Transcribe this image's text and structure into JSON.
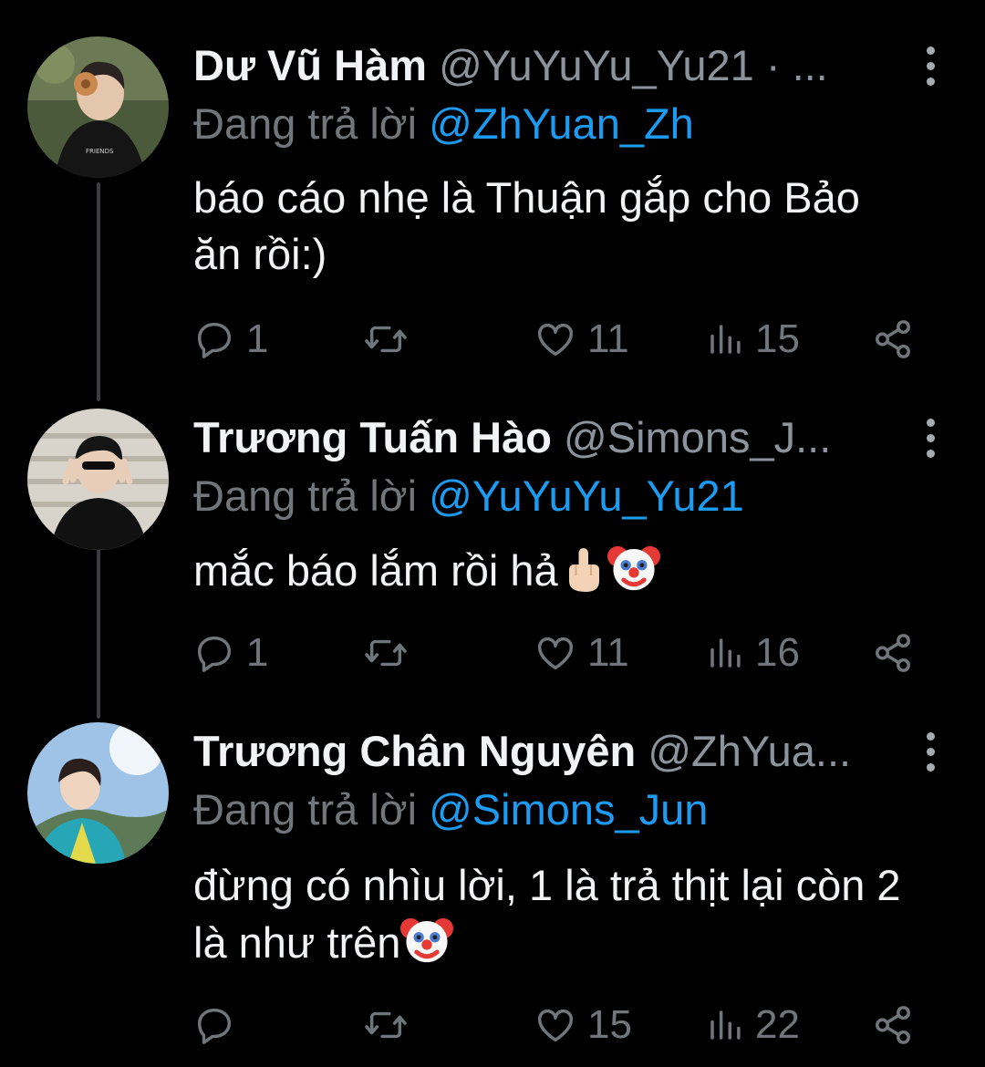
{
  "replying_prefix": "Đang trả lời",
  "colors": {
    "background": "#000000",
    "mention": "#1d9bf0",
    "muted": "#71767b",
    "text": "#f2f3f4"
  },
  "tweets": [
    {
      "name": "Dư Vũ Hàm",
      "handle": "@YuYuYu_Yu21 · ...",
      "replying_to": "@ZhYuan_Zh",
      "text": "báo cáo nhẹ là Thuận gắp cho Bảo ăn rồi:)",
      "emojis": [],
      "reply_count": "1",
      "retweet_count": "",
      "like_count": "11",
      "view_count": "15"
    },
    {
      "name": "Trương Tuấn Hào",
      "handle": "@Simons_J...",
      "replying_to": "@YuYuYu_Yu21",
      "text": "mắc báo lắm rồi hả",
      "emojis": [
        "middle-finger-emoji",
        "clown-face-emoji"
      ],
      "reply_count": "1",
      "retweet_count": "",
      "like_count": "11",
      "view_count": "16"
    },
    {
      "name": "Trương Chân Nguyên",
      "handle": "@ZhYua...",
      "replying_to": "@Simons_Jun",
      "text": "đừng có nhìu lời, 1 là trả thịt lại còn 2 là như trên",
      "emojis": [
        "clown-face-emoji"
      ],
      "reply_count": "",
      "retweet_count": "",
      "like_count": "15",
      "view_count": "22"
    }
  ]
}
